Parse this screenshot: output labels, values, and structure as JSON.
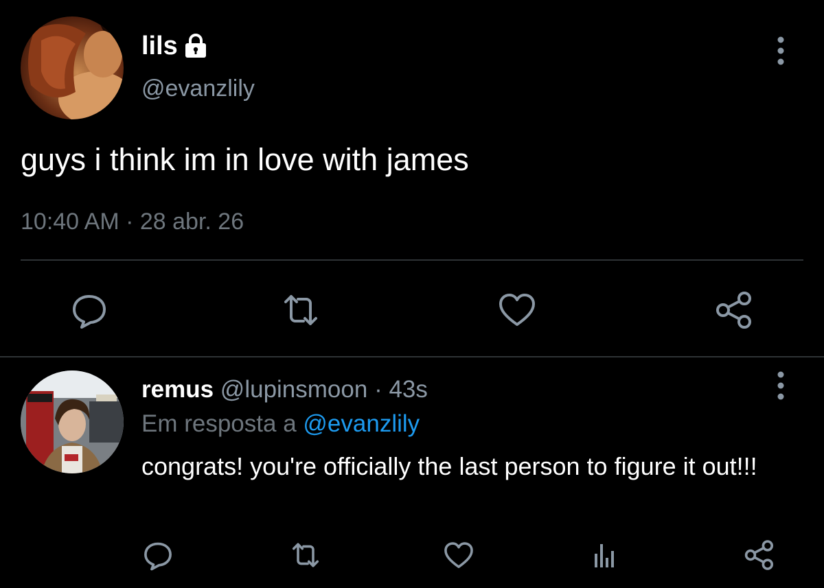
{
  "colors": {
    "background": "#000000",
    "primary_text": "#ffffff",
    "secondary_text": "#8b98a5",
    "muted_text": "#6e767d",
    "link": "#1d9bf0",
    "divider": "#2f3336",
    "icon": "#8b98a5"
  },
  "main_tweet": {
    "display_name": "lils",
    "handle": "@evanzlily",
    "text": "guys i think im in love with james",
    "meta": "10:40 AM · 28 abr. 26",
    "icons": {
      "verified_lock": "lock-icon",
      "more": "more-vertical-icon",
      "reply": "reply-icon",
      "retweet": "retweet-icon",
      "like": "heart-icon",
      "share": "share-icon"
    }
  },
  "reply_tweet": {
    "display_name": "remus",
    "handle": "@lupinsmoon",
    "separator": "·",
    "time": "43s",
    "reply_context_prefix": "Em resposta a",
    "reply_context_mention": "@evanzlily",
    "text": "congrats! you're officially the last person to figure it out!!!",
    "icons": {
      "more": "more-vertical-icon",
      "reply": "reply-icon",
      "retweet": "retweet-icon",
      "like": "heart-icon",
      "stats": "stats-icon",
      "share": "share-icon"
    }
  }
}
